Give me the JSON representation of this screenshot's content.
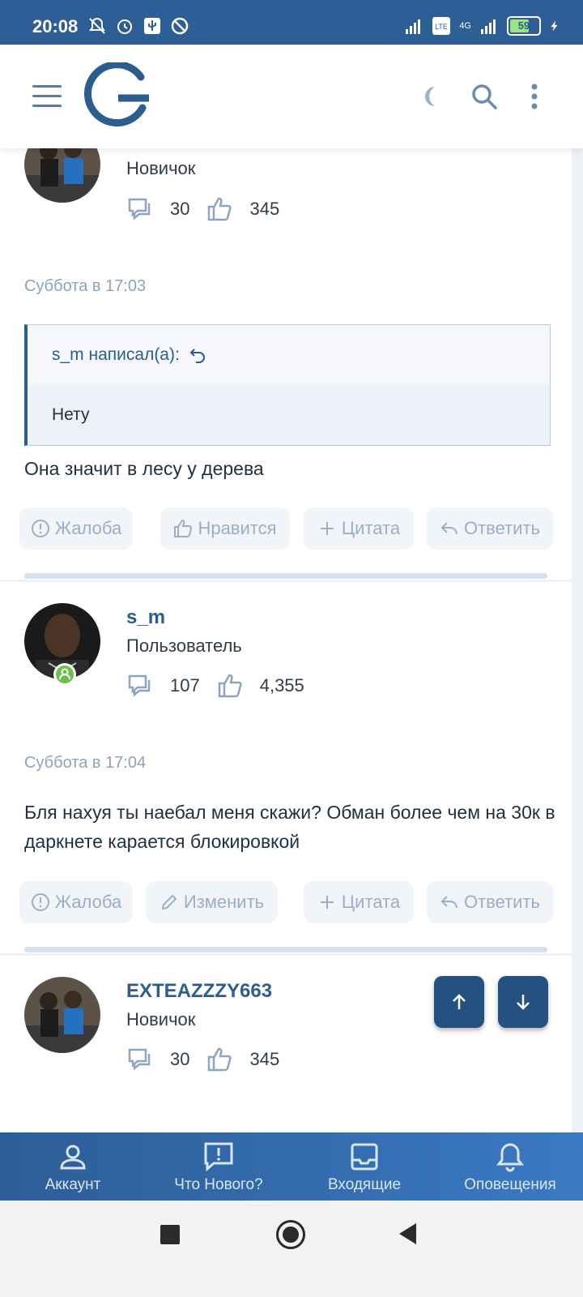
{
  "status_bar": {
    "time": "20:08",
    "battery": "59",
    "network": "4G"
  },
  "header": {
    "menu_icon": "hamburger-icon",
    "logo_icon": "logo-g",
    "theme_icon": "moon-icon",
    "search_icon": "search-icon",
    "more_icon": "more-vertical-icon"
  },
  "posts": [
    {
      "user_title": "Новичок",
      "messages": "30",
      "likes": "345",
      "date": "Суббота в 17:03",
      "quote": {
        "author_line": "s_m написал(а):",
        "text": "Нету"
      },
      "text": "Она значит в лесу у дерева",
      "actions": {
        "report": "Жалоба",
        "like": "Нравится",
        "quote": "Цитата",
        "reply": "Ответить"
      }
    },
    {
      "username": "s_m",
      "user_title": "Пользователь",
      "messages": "107",
      "likes": "4,355",
      "date": "Суббота в 17:04",
      "text": "Бля нахуя ты наебал меня скажи? Обман более чем на 30к в даркнете карается блокировкой",
      "actions": {
        "report": "Жалоба",
        "edit": "Изменить",
        "quote": "Цитата",
        "reply": "Ответить"
      }
    },
    {
      "username": "EXTEAZZZY663",
      "user_title": "Новичок",
      "messages": "30",
      "likes": "345"
    }
  ],
  "bottom_nav": [
    {
      "label": "Аккаунт",
      "icon": "user-icon"
    },
    {
      "label": "Что Нового?",
      "icon": "news-icon"
    },
    {
      "label": "Входящие",
      "icon": "inbox-icon"
    },
    {
      "label": "Оповещения",
      "icon": "bell-icon"
    }
  ],
  "colors": {
    "status_bar": "#2d5e96",
    "accent": "#2b5d8e",
    "button_bg": "#f1f4f9",
    "fab": "#24517f",
    "online": "#6cc04a"
  }
}
